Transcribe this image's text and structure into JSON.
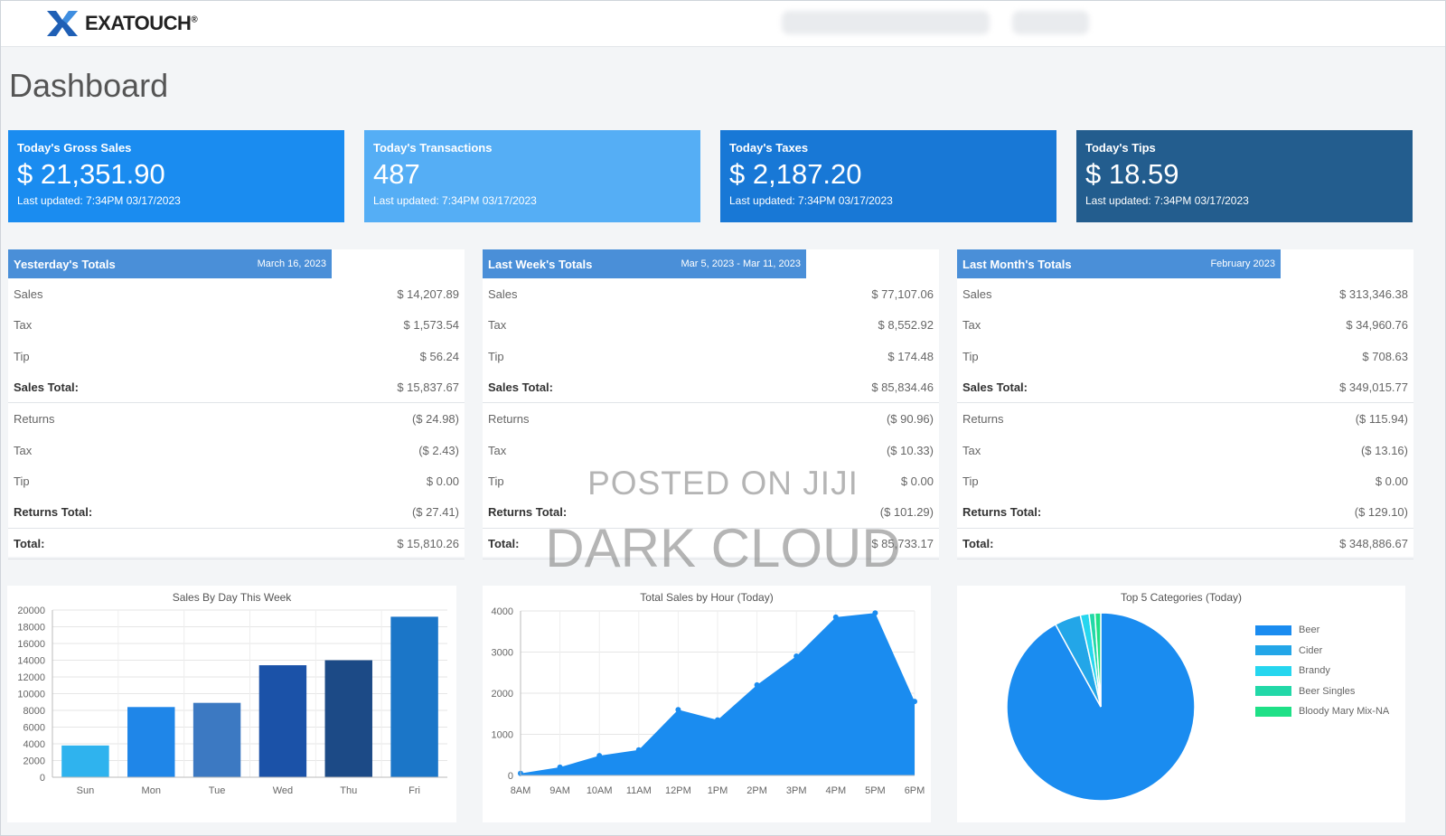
{
  "header": {
    "brand": "EXATOUCH",
    "brand_mark": "®"
  },
  "page_title": "Dashboard",
  "kpis": [
    {
      "title": "Today's Gross Sales",
      "value": "$ 21,351.90",
      "updated": "Last updated: 7:34PM 03/17/2023",
      "color": "#1a8cf0"
    },
    {
      "title": "Today's Transactions",
      "value": "487",
      "updated": "Last updated: 7:34PM 03/17/2023",
      "color": "#55aef5"
    },
    {
      "title": "Today's Taxes",
      "value": "$ 2,187.20",
      "updated": "Last updated: 7:34PM 03/17/2023",
      "color": "#1878d6"
    },
    {
      "title": "Today's Tips",
      "value": "$ 18.59",
      "updated": "Last updated: 7:34PM 03/17/2023",
      "color": "#235d8e"
    }
  ],
  "totals": [
    {
      "title": "Yesterday's Totals",
      "date": "March 16, 2023",
      "rows": [
        {
          "label": "Sales",
          "amount": "$ 14,207.89",
          "bold": false
        },
        {
          "label": "Tax",
          "amount": "$ 1,573.54",
          "bold": false
        },
        {
          "label": "Tip",
          "amount": "$ 56.24",
          "bold": false
        },
        {
          "label": "Sales Total:",
          "amount": "$ 15,837.67",
          "bold": true
        },
        {
          "label": "Returns",
          "amount": "($ 24.98)",
          "bold": false
        },
        {
          "label": "Tax",
          "amount": "($ 2.43)",
          "bold": false
        },
        {
          "label": "Tip",
          "amount": "$ 0.00",
          "bold": false
        },
        {
          "label": "Returns Total:",
          "amount": "($ 27.41)",
          "bold": true
        },
        {
          "label": "Total:",
          "amount": "$ 15,810.26",
          "bold": true
        }
      ]
    },
    {
      "title": "Last Week's Totals",
      "date": "Mar 5, 2023 - Mar 11, 2023",
      "rows": [
        {
          "label": "Sales",
          "amount": "$ 77,107.06",
          "bold": false
        },
        {
          "label": "Tax",
          "amount": "$ 8,552.92",
          "bold": false
        },
        {
          "label": "Tip",
          "amount": "$ 174.48",
          "bold": false
        },
        {
          "label": "Sales Total:",
          "amount": "$ 85,834.46",
          "bold": true
        },
        {
          "label": "Returns",
          "amount": "($ 90.96)",
          "bold": false
        },
        {
          "label": "Tax",
          "amount": "($ 10.33)",
          "bold": false
        },
        {
          "label": "Tip",
          "amount": "$ 0.00",
          "bold": false
        },
        {
          "label": "Returns Total:",
          "amount": "($ 101.29)",
          "bold": true
        },
        {
          "label": "Total:",
          "amount": "$ 85,733.17",
          "bold": true
        }
      ]
    },
    {
      "title": "Last Month's Totals",
      "date": "February 2023",
      "rows": [
        {
          "label": "Sales",
          "amount": "$ 313,346.38",
          "bold": false
        },
        {
          "label": "Tax",
          "amount": "$ 34,960.76",
          "bold": false
        },
        {
          "label": "Tip",
          "amount": "$ 708.63",
          "bold": false
        },
        {
          "label": "Sales Total:",
          "amount": "$ 349,015.77",
          "bold": true
        },
        {
          "label": "Returns",
          "amount": "($ 115.94)",
          "bold": false
        },
        {
          "label": "Tax",
          "amount": "($ 13.16)",
          "bold": false
        },
        {
          "label": "Tip",
          "amount": "$ 0.00",
          "bold": false
        },
        {
          "label": "Returns Total:",
          "amount": "($ 129.10)",
          "bold": true
        },
        {
          "label": "Total:",
          "amount": "$ 348,886.67",
          "bold": true
        }
      ]
    }
  ],
  "watermark": {
    "line1": "POSTED ON JIJI",
    "line2": "DARK CLOUD"
  },
  "chart_data": [
    {
      "type": "bar",
      "title": "Sales By Day This Week",
      "categories": [
        "Sun",
        "Mon",
        "Tue",
        "Wed",
        "Thu",
        "Fri"
      ],
      "values": [
        3800,
        8400,
        8900,
        13400,
        14000,
        19200
      ],
      "colors": [
        "#2fb3ee",
        "#1f86e8",
        "#3c79c2",
        "#1b52a8",
        "#1c4a86",
        "#1b76c8"
      ],
      "yticks": [
        "0",
        "2000",
        "4000",
        "6000",
        "8000",
        "10000",
        "12000",
        "14000",
        "16000",
        "18000",
        "20000"
      ],
      "ylim": [
        0,
        20000
      ],
      "grid": true
    },
    {
      "type": "area",
      "title": "Total Sales by Hour (Today)",
      "x": [
        "8AM",
        "9AM",
        "10AM",
        "11AM",
        "12PM",
        "1PM",
        "2PM",
        "3PM",
        "4PM",
        "5PM",
        "6PM"
      ],
      "values": [
        50,
        200,
        480,
        620,
        1600,
        1350,
        2200,
        2900,
        3850,
        3950,
        1800
      ],
      "yticks": [
        "0",
        "1000",
        "2000",
        "3000",
        "4000"
      ],
      "ylim": [
        0,
        4000
      ],
      "color": "#1a8cf0",
      "grid": true
    },
    {
      "type": "pie",
      "title": "Top 5 Categories (Today)",
      "labels": [
        "Beer",
        "Cider",
        "Brandy",
        "Beer Singles",
        "Bloody Mary Mix-NA"
      ],
      "values": [
        92.0,
        4.5,
        1.5,
        1.0,
        1.0
      ],
      "colors": [
        "#1a8cf0",
        "#23a6e8",
        "#26d6ef",
        "#22d8a8",
        "#1fe087"
      ],
      "legend": "right"
    }
  ]
}
